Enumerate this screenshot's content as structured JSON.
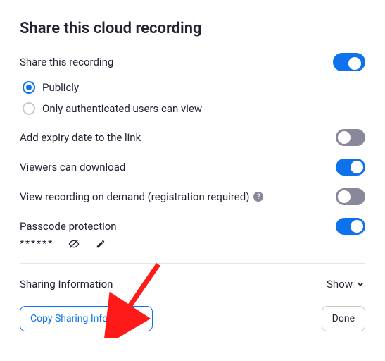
{
  "title": "Share this cloud recording",
  "share_label": "Share this recording",
  "radios": {
    "publicly": "Publicly",
    "authenticated": "Only authenticated users can view"
  },
  "options": {
    "expiry": "Add expiry date to the link",
    "download": "Viewers can download",
    "ondemand": "View recording on demand (registration required)",
    "passcode": "Passcode protection"
  },
  "passcode_mask": "******",
  "sharing_info": "Sharing Information",
  "show": "Show",
  "copy_btn": "Copy Sharing Information",
  "done_btn": "Done"
}
